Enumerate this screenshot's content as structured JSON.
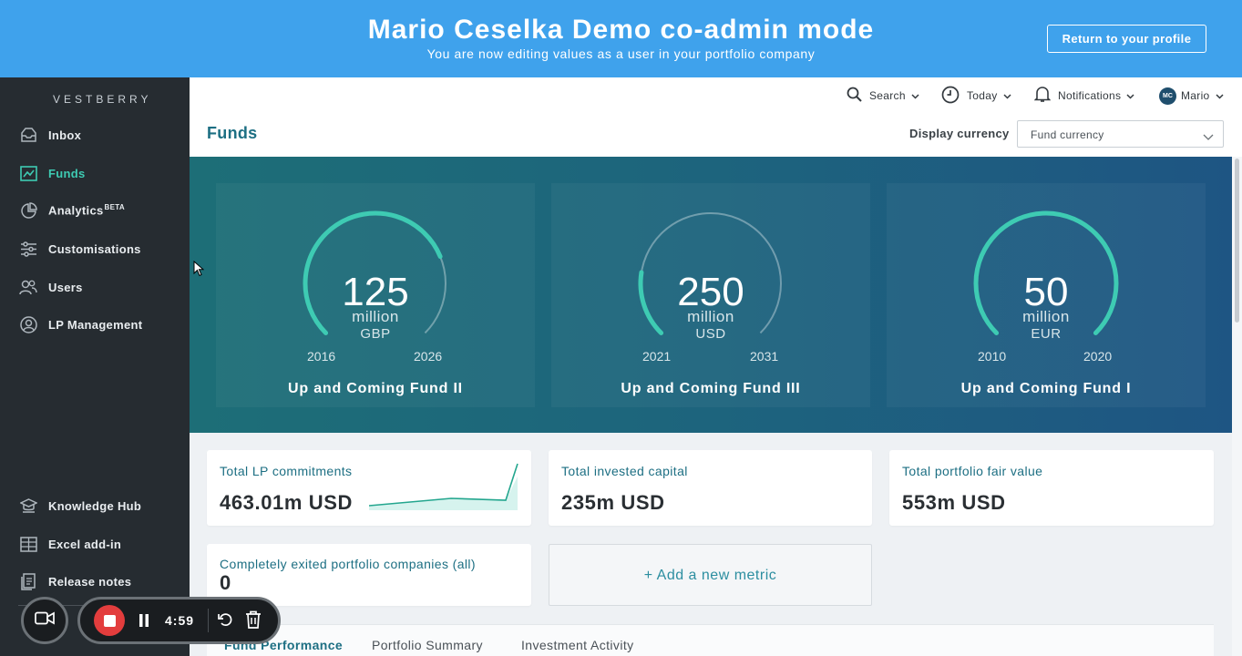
{
  "banner": {
    "title": "Mario Ceselka Demo co-admin mode",
    "subtitle": "You are now editing values as a user in your portfolio company",
    "return_button": "Return to your profile"
  },
  "sidebar": {
    "brand": "VESTBERRY",
    "items": [
      {
        "label": "Inbox",
        "icon": "inbox-icon",
        "active": false
      },
      {
        "label": "Funds",
        "icon": "funds-icon",
        "active": true
      },
      {
        "label": "Analytics",
        "badge": "BETA",
        "icon": "analytics-icon",
        "active": false
      },
      {
        "label": "Customisations",
        "icon": "sliders-icon",
        "active": false
      },
      {
        "label": "Users",
        "icon": "users-icon",
        "active": false
      },
      {
        "label": "LP Management",
        "icon": "lp-management-icon",
        "active": false
      }
    ],
    "bottom_items": [
      {
        "label": "Knowledge Hub",
        "icon": "knowledge-hub-icon"
      },
      {
        "label": "Excel add-in",
        "icon": "excel-addin-icon"
      },
      {
        "label": "Release notes",
        "icon": "release-notes-icon"
      }
    ]
  },
  "topbar": {
    "search": "Search",
    "today": "Today",
    "notifications": "Notifications",
    "user_initials": "MC",
    "user_name": "Mario"
  },
  "page": {
    "title": "Funds",
    "display_currency_label": "Display currency",
    "display_currency_value": "Fund currency"
  },
  "funds": [
    {
      "amount": "125",
      "unit": "million",
      "currency": "GBP",
      "start_year": "2016",
      "end_year": "2026",
      "name": "Up and Coming Fund II",
      "progress": 0.75
    },
    {
      "amount": "250",
      "unit": "million",
      "currency": "USD",
      "start_year": "2021",
      "end_year": "2031",
      "name": "Up and Coming Fund III",
      "progress": 0.2
    },
    {
      "amount": "50",
      "unit": "million",
      "currency": "EUR",
      "start_year": "2010",
      "end_year": "2020",
      "name": "Up and Coming Fund I",
      "progress": 1.0
    }
  ],
  "metrics": {
    "lp_commitments": {
      "label": "Total LP commitments",
      "value": "463.01m USD"
    },
    "invested_capital": {
      "label": "Total invested capital",
      "value": "235m USD"
    },
    "fair_value": {
      "label": "Total portfolio fair value",
      "value": "553m USD"
    },
    "exited": {
      "label": "Completely exited portfolio companies (all)",
      "value": "0"
    },
    "add_new": "+ Add a new metric"
  },
  "tabs": [
    {
      "label": "Fund Performance",
      "active": true
    },
    {
      "label": "Portfolio Summary",
      "active": false
    },
    {
      "label": "Investment Activity",
      "active": false
    }
  ],
  "recorder": {
    "time": "4:59"
  },
  "colors": {
    "banner": "#3fa2ec",
    "sidebar": "#262c31",
    "accent": "#3ecbb3",
    "title": "#1d6f83",
    "gauge": "#3ecbb3"
  }
}
